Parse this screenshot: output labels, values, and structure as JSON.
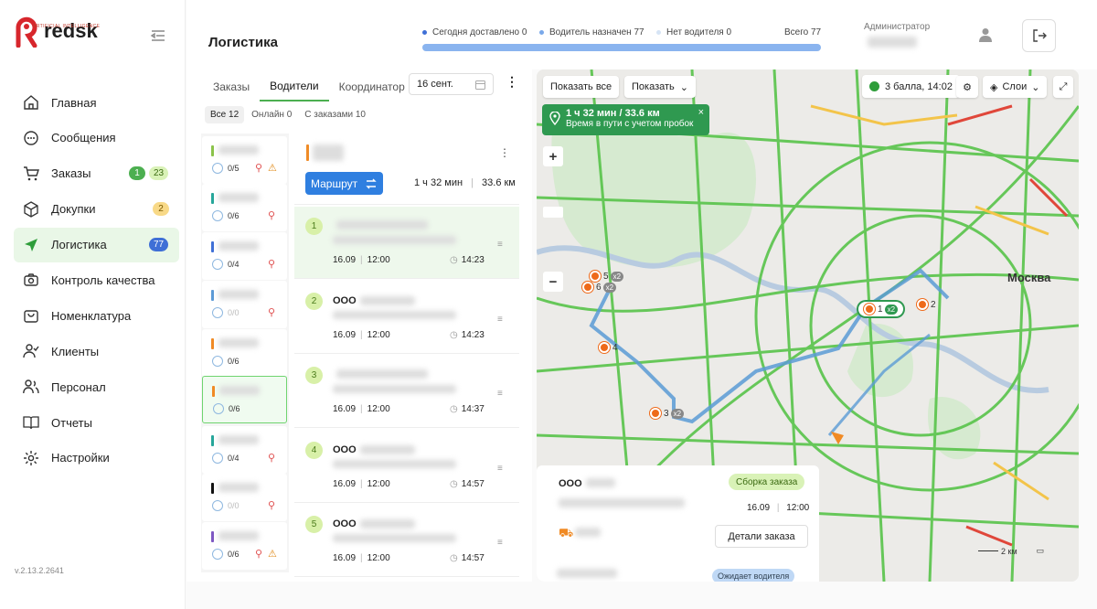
{
  "brand": {
    "name": "redsk",
    "subtitle": "ARTIFICIAL INTELLIGENCE"
  },
  "version": "v.2.13.2.2641",
  "colors": {
    "brand_red": "#d7262c",
    "accent_green": "#4caf50",
    "route_blue": "#2f7fe0"
  },
  "nav": {
    "items": [
      {
        "label": "Главная",
        "icon": "home-icon"
      },
      {
        "label": "Сообщения",
        "icon": "message-icon"
      },
      {
        "label": "Заказы",
        "icon": "cart-icon",
        "badges": [
          "1",
          "23"
        ]
      },
      {
        "label": "Докупки",
        "icon": "box-icon",
        "badges": [
          "2"
        ]
      },
      {
        "label": "Логистика",
        "icon": "navigation-icon",
        "badges": [
          "77"
        ],
        "active": true
      },
      {
        "label": "Контроль качества",
        "icon": "camera-icon"
      },
      {
        "label": "Номенклатура",
        "icon": "bag-icon"
      },
      {
        "label": "Клиенты",
        "icon": "user-check-icon"
      },
      {
        "label": "Персонал",
        "icon": "users-icon"
      },
      {
        "label": "Отчеты",
        "icon": "book-icon"
      },
      {
        "label": "Настройки",
        "icon": "gear-icon"
      }
    ]
  },
  "header": {
    "title": "Логистика",
    "stats": {
      "delivered": "Сегодня доставлено 0",
      "assigned": "Водитель назначен 77",
      "no_driver": "Нет водителя 0",
      "total": "Всего 77"
    },
    "role": "Администратор"
  },
  "panel": {
    "tabs": [
      "Заказы",
      "Водители",
      "Координатор"
    ],
    "active_tab": "Водители",
    "date": "16 сент.",
    "filters": [
      "Все 12",
      "Онлайн 0",
      "С заказами 10"
    ],
    "drivers": [
      {
        "count": "0/5",
        "color": "#8bc34a",
        "pin": true,
        "warn": true
      },
      {
        "count": "0/6",
        "color": "#26a69a",
        "pin": true
      },
      {
        "count": "0/4",
        "color": "#3f6fd6",
        "pin": true
      },
      {
        "count": "0/0",
        "color": "#5c9ad6",
        "pin": true,
        "faded": true
      },
      {
        "count": "0/6",
        "color": "#f08a24"
      },
      {
        "count": "0/6",
        "color": "#f08a24",
        "selected": true
      },
      {
        "count": "0/4",
        "color": "#26a69a",
        "pin": true
      },
      {
        "count": "0/0",
        "color": "#111111",
        "pin": true,
        "faded": true
      },
      {
        "count": "0/6",
        "color": "#7e57c2",
        "pin": true,
        "warn": true
      }
    ],
    "route": {
      "button": "Маршрут",
      "duration": "1 ч 32 мин",
      "distance": "33.6 км",
      "stops": [
        {
          "num": "1",
          "prefix": "",
          "date": "16.09",
          "time_from": "12:00",
          "eta": "14:23"
        },
        {
          "num": "2",
          "prefix": "ООО",
          "date": "16.09",
          "time_from": "12:00",
          "eta": "14:23"
        },
        {
          "num": "3",
          "prefix": "",
          "date": "16.09",
          "time_from": "12:00",
          "eta": "14:37"
        },
        {
          "num": "4",
          "prefix": "ООО",
          "date": "16.09",
          "time_from": "12:00",
          "eta": "14:57"
        },
        {
          "num": "5",
          "prefix": "ООО",
          "date": "16.09",
          "time_from": "12:00",
          "eta": "14:57"
        }
      ]
    }
  },
  "map": {
    "show_all": "Показать все",
    "show": "Показать",
    "traffic": "3 балла, 14:02",
    "layers": "Слои",
    "route_tip": {
      "title": "1 ч 32 мин / 33.6 км",
      "sub": "Время в пути с учетом пробок"
    },
    "zoom_in": "+",
    "zoom_out": "−",
    "city": "Москва",
    "scale": "2 км",
    "markers": [
      {
        "label": "1",
        "extra": "x2"
      },
      {
        "label": "2",
        "extra": ""
      },
      {
        "label": "3",
        "extra": "x2"
      },
      {
        "label": "4",
        "extra": ""
      },
      {
        "label": "5",
        "extra": "x2"
      },
      {
        "label": "6",
        "extra": "x2"
      }
    ],
    "order_card": {
      "prefix": "ООО",
      "status": "Сборка заказа",
      "date": "16.09",
      "time": "12:00",
      "details_button": "Детали заказа",
      "waiting": "Ожидает водителя"
    }
  }
}
